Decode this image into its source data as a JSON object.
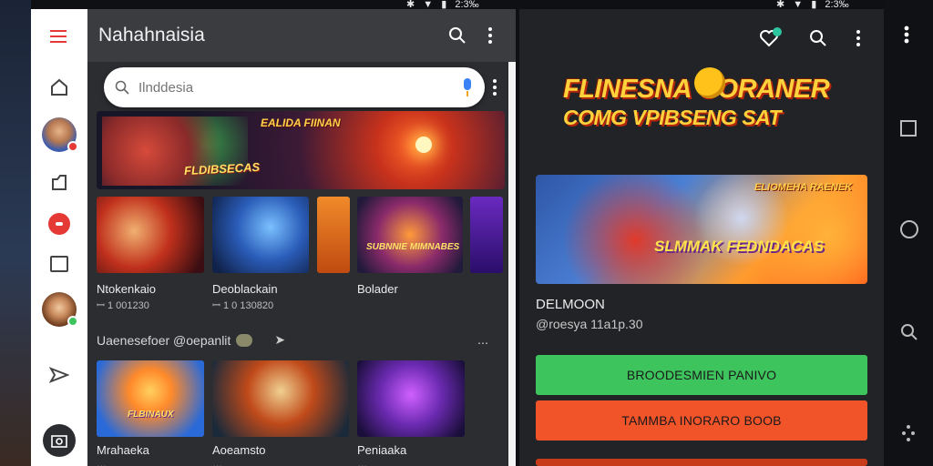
{
  "status": {
    "time": "2:3‰",
    "time_right": "2:3‰"
  },
  "left_app": {
    "title": "Nahahnaisia",
    "search": {
      "placeholder": "Ilnddesia"
    },
    "rail_items": [
      "home-icon",
      "avatar",
      "share-icon",
      "record-icon",
      "square-icon",
      "avatar",
      "send-icon",
      "camera-icon"
    ],
    "banner": {
      "title": "EALIDA FIINAN",
      "subtitle": "FLDIBSECAS"
    },
    "row1": [
      {
        "label": "Ntokenkaio",
        "meta": "ꟷ 1 001230"
      },
      {
        "label": "Deoblackain",
        "meta": "ꟷ 1 0 130820"
      },
      {
        "label": "Bolader",
        "meta": ""
      }
    ],
    "row1_art": {
      "card3": "SUBNNIE MIMNABES"
    },
    "section_title": "Uaenesefoer @oepanlit",
    "row2": [
      {
        "label": "Mrahaeka",
        "meta": "…"
      },
      {
        "label": "Aoeamsto",
        "meta": "…"
      },
      {
        "label": "Peniaaka",
        "meta": "…"
      }
    ],
    "row2_art": {
      "card1": "FLBINAUX"
    }
  },
  "right_app": {
    "logo_line1": "FLINESNA  OORANER",
    "logo_line2": "COMG VPIBSENG SAT",
    "hero": {
      "title": "ELIOMEHA RAENEK",
      "subtitle": "SLMMAK FEDNDACAS"
    },
    "game_title": "DELMOON",
    "game_meta": "@roesya 11a1p.30",
    "primary_button": "BROODESMIEN PANIVO",
    "secondary_button": "TAMMBA INORARO BOOB"
  },
  "colors": {
    "accent_red": "#e53935",
    "green": "#3ec45c",
    "orange_red": "#f2542a",
    "dark_bg": "#222326"
  }
}
